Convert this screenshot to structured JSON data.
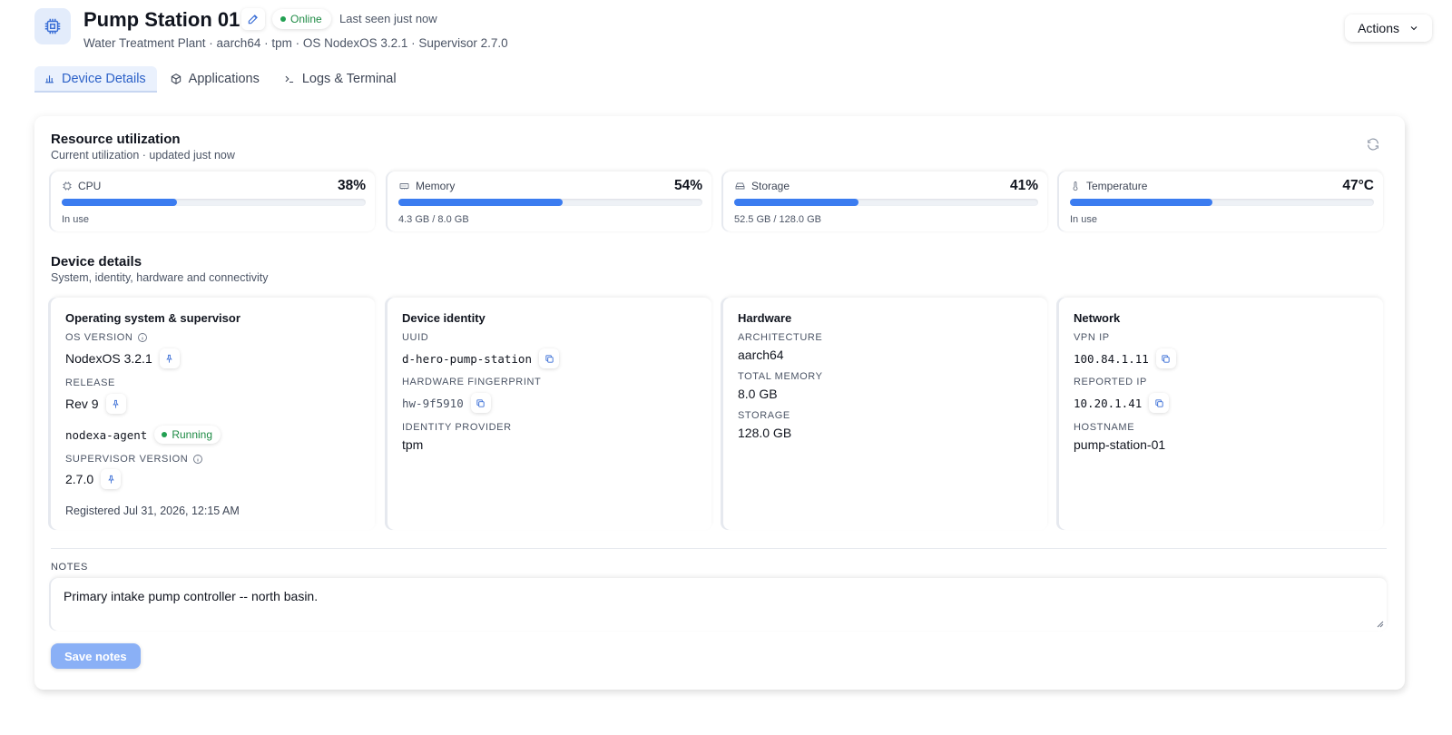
{
  "header": {
    "title": "Pump Station 01",
    "status": "Online",
    "last_seen": "Last seen just now",
    "subtitle": "Water Treatment Plant · aarch64 · tpm · OS NodexOS 3.2.1 · Supervisor 2.7.0",
    "actions_label": "Actions"
  },
  "tabs": [
    {
      "label": "Device Details",
      "icon": "chart-icon",
      "active": true
    },
    {
      "label": "Applications",
      "icon": "box-icon",
      "active": false
    },
    {
      "label": "Logs & Terminal",
      "icon": "terminal-icon",
      "active": false
    }
  ],
  "resources": {
    "title": "Resource utilization",
    "subtitle": "Current utilization · updated just now",
    "metrics": [
      {
        "label": "CPU",
        "icon": "cpu-icon",
        "value": "38%",
        "fraction": 0.38,
        "foot": "In use"
      },
      {
        "label": "Memory",
        "icon": "memory-icon",
        "value": "54%",
        "fraction": 0.54,
        "foot": "4.3 GB / 8.0 GB"
      },
      {
        "label": "Storage",
        "icon": "storage-icon",
        "value": "41%",
        "fraction": 0.41,
        "foot": "52.5 GB / 128.0 GB"
      },
      {
        "label": "Temperature",
        "icon": "thermometer-icon",
        "value": "47°C",
        "fraction": 0.47,
        "foot": "In use"
      }
    ]
  },
  "details": {
    "title": "Device details",
    "subtitle": "System, identity, hardware and connectivity",
    "os": {
      "title": "Operating system & supervisor",
      "os_version_label": "OS VERSION",
      "os_version": "NodexOS 3.2.1",
      "release_label": "RELEASE",
      "release": "Rev 9",
      "agent": "nodexa-agent",
      "agent_status": "Running",
      "supervisor_label": "SUPERVISOR VERSION",
      "supervisor_version": "2.7.0",
      "registered": "Registered Jul 31, 2026, 12:15 AM"
    },
    "identity": {
      "title": "Device identity",
      "uuid_label": "UUID",
      "uuid": "d-hero-pump-station",
      "fingerprint_label": "HARDWARE FINGERPRINT",
      "fingerprint": "hw-9f5910",
      "provider_label": "IDENTITY PROVIDER",
      "provider": "tpm"
    },
    "hardware": {
      "title": "Hardware",
      "arch_label": "ARCHITECTURE",
      "arch": "aarch64",
      "memory_label": "TOTAL MEMORY",
      "memory": "8.0 GB",
      "storage_label": "STORAGE",
      "storage": "128.0 GB"
    },
    "network": {
      "title": "Network",
      "vpn_label": "VPN IP",
      "vpn": "100.84.1.11",
      "reported_label": "REPORTED IP",
      "reported": "10.20.1.41",
      "hostname_label": "HOSTNAME",
      "hostname": "pump-station-01"
    }
  },
  "notes": {
    "label": "NOTES",
    "value": "Primary intake pump controller -- north basin.",
    "save_label": "Save notes"
  },
  "colors": {
    "accent": "#3b7cf0",
    "online": "#22a052",
    "save_button": "#8ab0f6"
  }
}
